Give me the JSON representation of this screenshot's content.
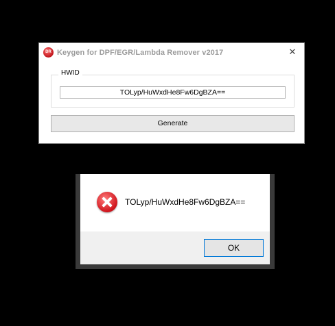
{
  "keygen_window": {
    "title": "Keygen for DPF/EGR/Lambda Remover v2017",
    "app_icon_text": "DR",
    "close_label": "✕",
    "hwid_group_label": "HWID",
    "hwid_value": "TOLyp/HuWxdHe8Fw6DgBZA==",
    "generate_label": "Generate"
  },
  "message_box": {
    "icon": "error-icon",
    "message": "TOLyp/HuWxdHe8Fw6DgBZA==",
    "ok_label": "OK"
  },
  "colors": {
    "background": "#000000",
    "error_red": "#d0141c",
    "focus_border": "#0078d7"
  }
}
